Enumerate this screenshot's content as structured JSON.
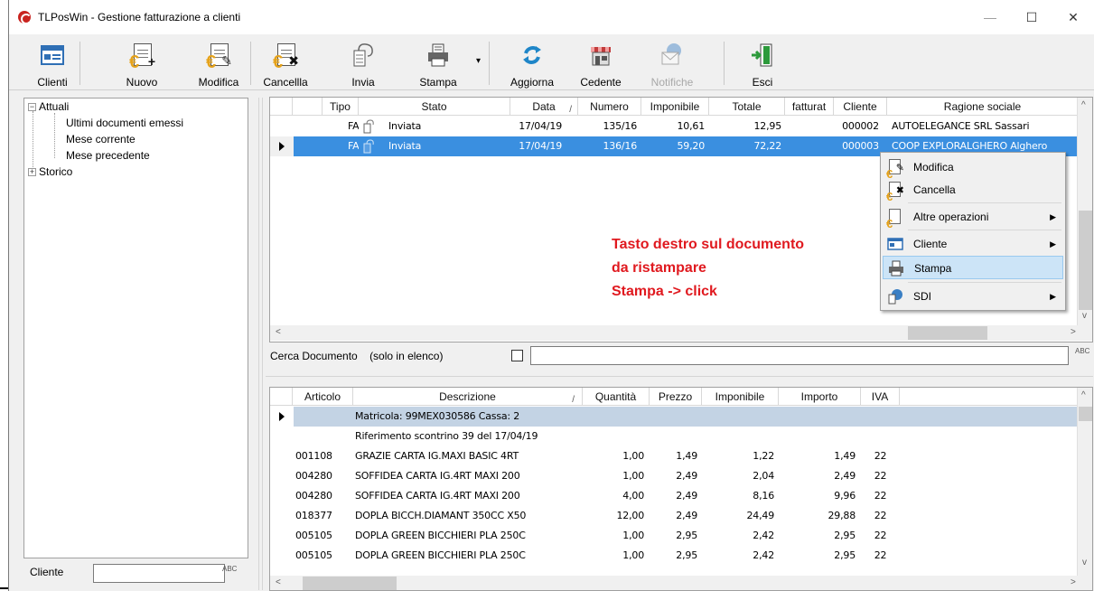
{
  "window": {
    "title": "TLPosWin - Gestione fatturazione a clienti",
    "controls": {
      "minimize": "—",
      "maximize": "☐",
      "close": "✕"
    }
  },
  "toolbar": {
    "clienti": "Clienti",
    "nuovo": "Nuovo",
    "modifica": "Modifica",
    "cancella": "Cancellla",
    "invia": "Invia",
    "stampa": "Stampa",
    "stampa_dropdown": "▾",
    "aggiorna": "Aggiorna",
    "cedente": "Cedente",
    "notifiche": "Notifiche",
    "esci": "Esci"
  },
  "tree": {
    "attuali": "Attuali",
    "ultimi": "Ultimi documenti emessi",
    "mese_corrente": "Mese corrente",
    "mese_precedente": "Mese precedente",
    "storico": "Storico",
    "exp_minus": "−",
    "exp_plus": "+"
  },
  "filter": {
    "cliente_label": "Cliente",
    "binoc": "ABC"
  },
  "documents": {
    "columns": {
      "tipo": "Tipo",
      "stato": "Stato",
      "data": "Data",
      "numero": "Numero",
      "imponibile": "Imponibile",
      "totale": "Totale",
      "fatturato": "fatturat",
      "cliente": "Cliente",
      "ragione": "Ragione sociale"
    },
    "sort_mark": "/",
    "rows": [
      {
        "tipo": "FA",
        "stato": "Inviata",
        "data": "17/04/19",
        "numero": "135/16",
        "imponibile": "10,61",
        "totale": "12,95",
        "cliente": "000002",
        "ragione": "AUTOELEGANCE SRL Sassari"
      },
      {
        "tipo": "FA",
        "stato": "Inviata",
        "data": "17/04/19",
        "numero": "136/16",
        "imponibile": "59,20",
        "totale": "72,22",
        "cliente": "000003",
        "ragione": "COOP EXPLORALGHERO Alghero"
      }
    ]
  },
  "search": {
    "label": "Cerca Documento",
    "hint": "(solo in elenco)",
    "value": ""
  },
  "annotation": {
    "line1": "Tasto destro sul documento",
    "line2": "da ristampare",
    "line3": "Stampa -> click"
  },
  "context_menu": {
    "modifica": "Modifica",
    "cancella": "Cancella",
    "altre": "Altre operazioni",
    "cliente": "Cliente",
    "stampa": "Stampa",
    "sdi": "SDI",
    "submenu_arrow": "▶"
  },
  "details": {
    "columns": {
      "articolo": "Articolo",
      "descrizione": "Descrizione",
      "quantita": "Quantità",
      "prezzo": "Prezzo",
      "imponibile": "Imponibile",
      "importo": "Importo",
      "iva": "IVA"
    },
    "sort_mark": "/",
    "matricola": "Matricola: 99MEX030586   Cassa: 2",
    "riferimento": "Riferimento scontrino 39 del 17/04/19",
    "rows": [
      {
        "articolo": "001108",
        "descrizione": "GRAZIE CARTA IG.MAXI BASIC 4RT",
        "quantita": "1,00",
        "prezzo": "1,49",
        "imponibile": "1,22",
        "importo": "1,49",
        "iva": "22"
      },
      {
        "articolo": "004280",
        "descrizione": "SOFFIDEA CARTA IG.4RT MAXI 200",
        "quantita": "1,00",
        "prezzo": "2,49",
        "imponibile": "2,04",
        "importo": "2,49",
        "iva": "22"
      },
      {
        "articolo": "004280",
        "descrizione": "SOFFIDEA CARTA IG.4RT MAXI 200",
        "quantita": "4,00",
        "prezzo": "2,49",
        "imponibile": "8,16",
        "importo": "9,96",
        "iva": "22"
      },
      {
        "articolo": "018377",
        "descrizione": "DOPLA BICCH.DIAMANT 350CC X50",
        "quantita": "12,00",
        "prezzo": "2,49",
        "imponibile": "24,49",
        "importo": "29,88",
        "iva": "22"
      },
      {
        "articolo": "005105",
        "descrizione": "DOPLA GREEN BICCHIERI PLA 250C",
        "quantita": "1,00",
        "prezzo": "2,95",
        "imponibile": "2,42",
        "importo": "2,95",
        "iva": "22"
      },
      {
        "articolo": "005105",
        "descrizione": "DOPLA GREEN BICCHIERI PLA 250C",
        "quantita": "1,00",
        "prezzo": "2,95",
        "imponibile": "2,42",
        "importo": "2,95",
        "iva": "22"
      }
    ]
  },
  "scroll": {
    "left": "<",
    "right": ">",
    "up": "^",
    "down": "v"
  },
  "colors": {
    "selection": "#3a8fe0",
    "matricola_row": "#c3d3e4",
    "annotation": "#e0191f",
    "menu_highlight": "#cce4f7",
    "euro_orange": "#e5a21a"
  },
  "icons": {
    "clienti": "client-card-icon",
    "nuovo": "new-invoice-icon",
    "modifica": "edit-invoice-icon",
    "cancella": "delete-invoice-icon",
    "invia": "send-document-icon",
    "stampa": "printer-icon",
    "aggiorna": "refresh-icon",
    "cedente": "shop-icon",
    "notifiche": "notification-envelope-icon",
    "esci": "exit-door-icon"
  }
}
